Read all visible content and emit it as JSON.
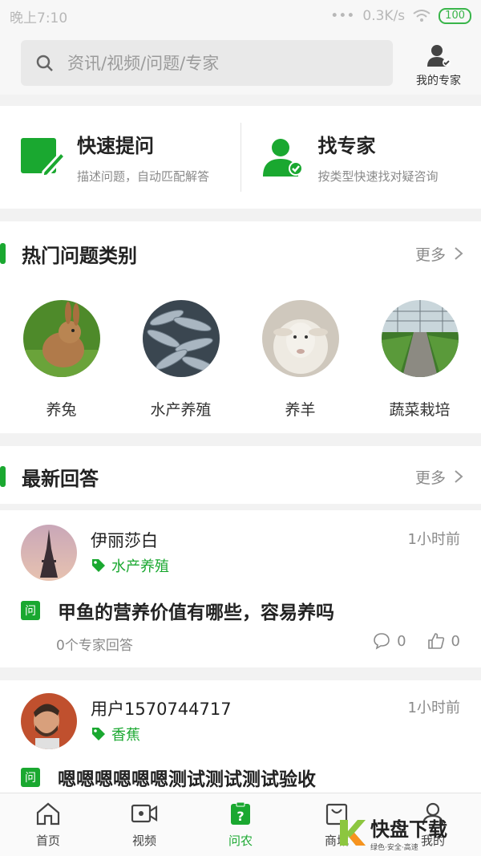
{
  "status": {
    "time": "晚上7:10",
    "speed": "0.3K/s",
    "battery": "100"
  },
  "search": {
    "placeholder": "资讯/视频/问题/专家",
    "my_expert": "我的专家"
  },
  "quick": [
    {
      "title": "快速提问",
      "sub": "描述问题，自动匹配解答"
    },
    {
      "title": "找专家",
      "sub": "按类型快速找对疑咨询"
    }
  ],
  "hot": {
    "title": "热门问题类别",
    "more": "更多",
    "items": [
      {
        "label": "养兔"
      },
      {
        "label": "水产养殖"
      },
      {
        "label": "养羊"
      },
      {
        "label": "蔬菜栽培"
      }
    ]
  },
  "latest": {
    "title": "最新回答",
    "more": "更多",
    "items": [
      {
        "user": "伊丽莎白",
        "tag": "水产养殖",
        "time": "1小时前",
        "badge": "问",
        "question": "甲鱼的营养价值有哪些，容易养吗",
        "answers": "0个专家回答",
        "comments": "0",
        "likes": "0"
      },
      {
        "user": "用户1570744717",
        "tag": "香蕉",
        "time": "1小时前",
        "badge": "问",
        "question": "嗯嗯嗯嗯嗯嗯测试测试测试验收"
      }
    ]
  },
  "nav": [
    {
      "label": "首页"
    },
    {
      "label": "视频"
    },
    {
      "label": "问农"
    },
    {
      "label": "商城"
    },
    {
      "label": "我的"
    }
  ],
  "watermark": {
    "big": "快盘下载",
    "small": "绿色·安全·高速"
  },
  "colors": {
    "accent": "#1aa830"
  }
}
